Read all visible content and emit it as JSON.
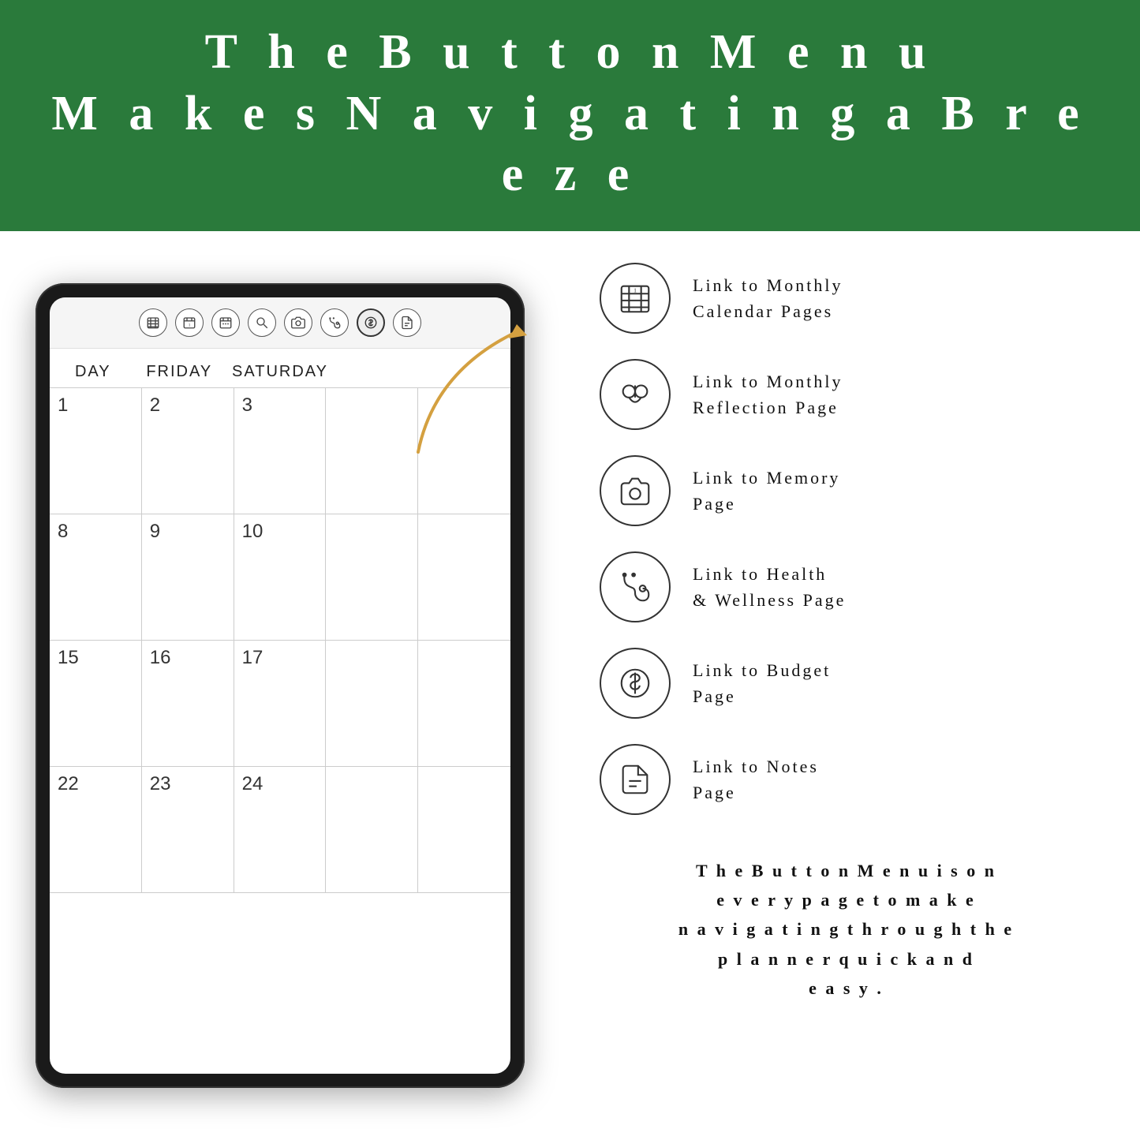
{
  "header": {
    "line1": "T h e   B u t t o n   M e n u",
    "line2": "M a k e s   N a v i g a t i n g   a   B r e e z e"
  },
  "tablet": {
    "toolbar_buttons": [
      {
        "id": "calendar-monthly",
        "icon": "calendar-grid",
        "active": false
      },
      {
        "id": "calendar-dates",
        "icon": "calendar-dates",
        "active": false
      },
      {
        "id": "calendar-small",
        "icon": "calendar-small",
        "active": false
      },
      {
        "id": "search",
        "icon": "magnify",
        "active": false
      },
      {
        "id": "camera",
        "icon": "camera",
        "active": false
      },
      {
        "id": "stethoscope",
        "icon": "stethoscope",
        "active": false
      },
      {
        "id": "dollar",
        "icon": "dollar",
        "active": true
      },
      {
        "id": "document",
        "icon": "document",
        "active": false
      }
    ],
    "calendar": {
      "days": [
        "DAY",
        "FRIDAY",
        "SATURDAY",
        "",
        ""
      ],
      "rows": [
        [
          "1",
          "2",
          "3",
          "",
          ""
        ],
        [
          "8",
          "9",
          "10",
          "",
          ""
        ],
        [
          "15",
          "16",
          "17",
          "",
          ""
        ],
        [
          "22",
          "23",
          "24",
          "",
          ""
        ]
      ]
    }
  },
  "features": [
    {
      "id": "monthly-calendar",
      "icon": "calendar-grid-icon",
      "label": "Link to Monthly\nCalendar Pages"
    },
    {
      "id": "monthly-reflection",
      "icon": "reflection-icon",
      "label": "Link to Monthly\nReflection Page"
    },
    {
      "id": "memory",
      "icon": "camera-icon",
      "label": "Link to Memory\nPage"
    },
    {
      "id": "health-wellness",
      "icon": "stethoscope-icon",
      "label": "Link to Health\n& Wellness Page"
    },
    {
      "id": "budget",
      "icon": "dollar-icon",
      "label": "Link to Budget\nPage"
    },
    {
      "id": "notes",
      "icon": "notes-icon",
      "label": "Link to Notes\nPage"
    }
  ],
  "footer_text": "T h e   B u t t o n   M e n u   i s   o n\ne v e r y   p a g e   t o   m a k e\nn a v i g a t i n g   t h r o u g h   t h e\np l a n n e r   q u i c k   a n d\ne a s y ."
}
